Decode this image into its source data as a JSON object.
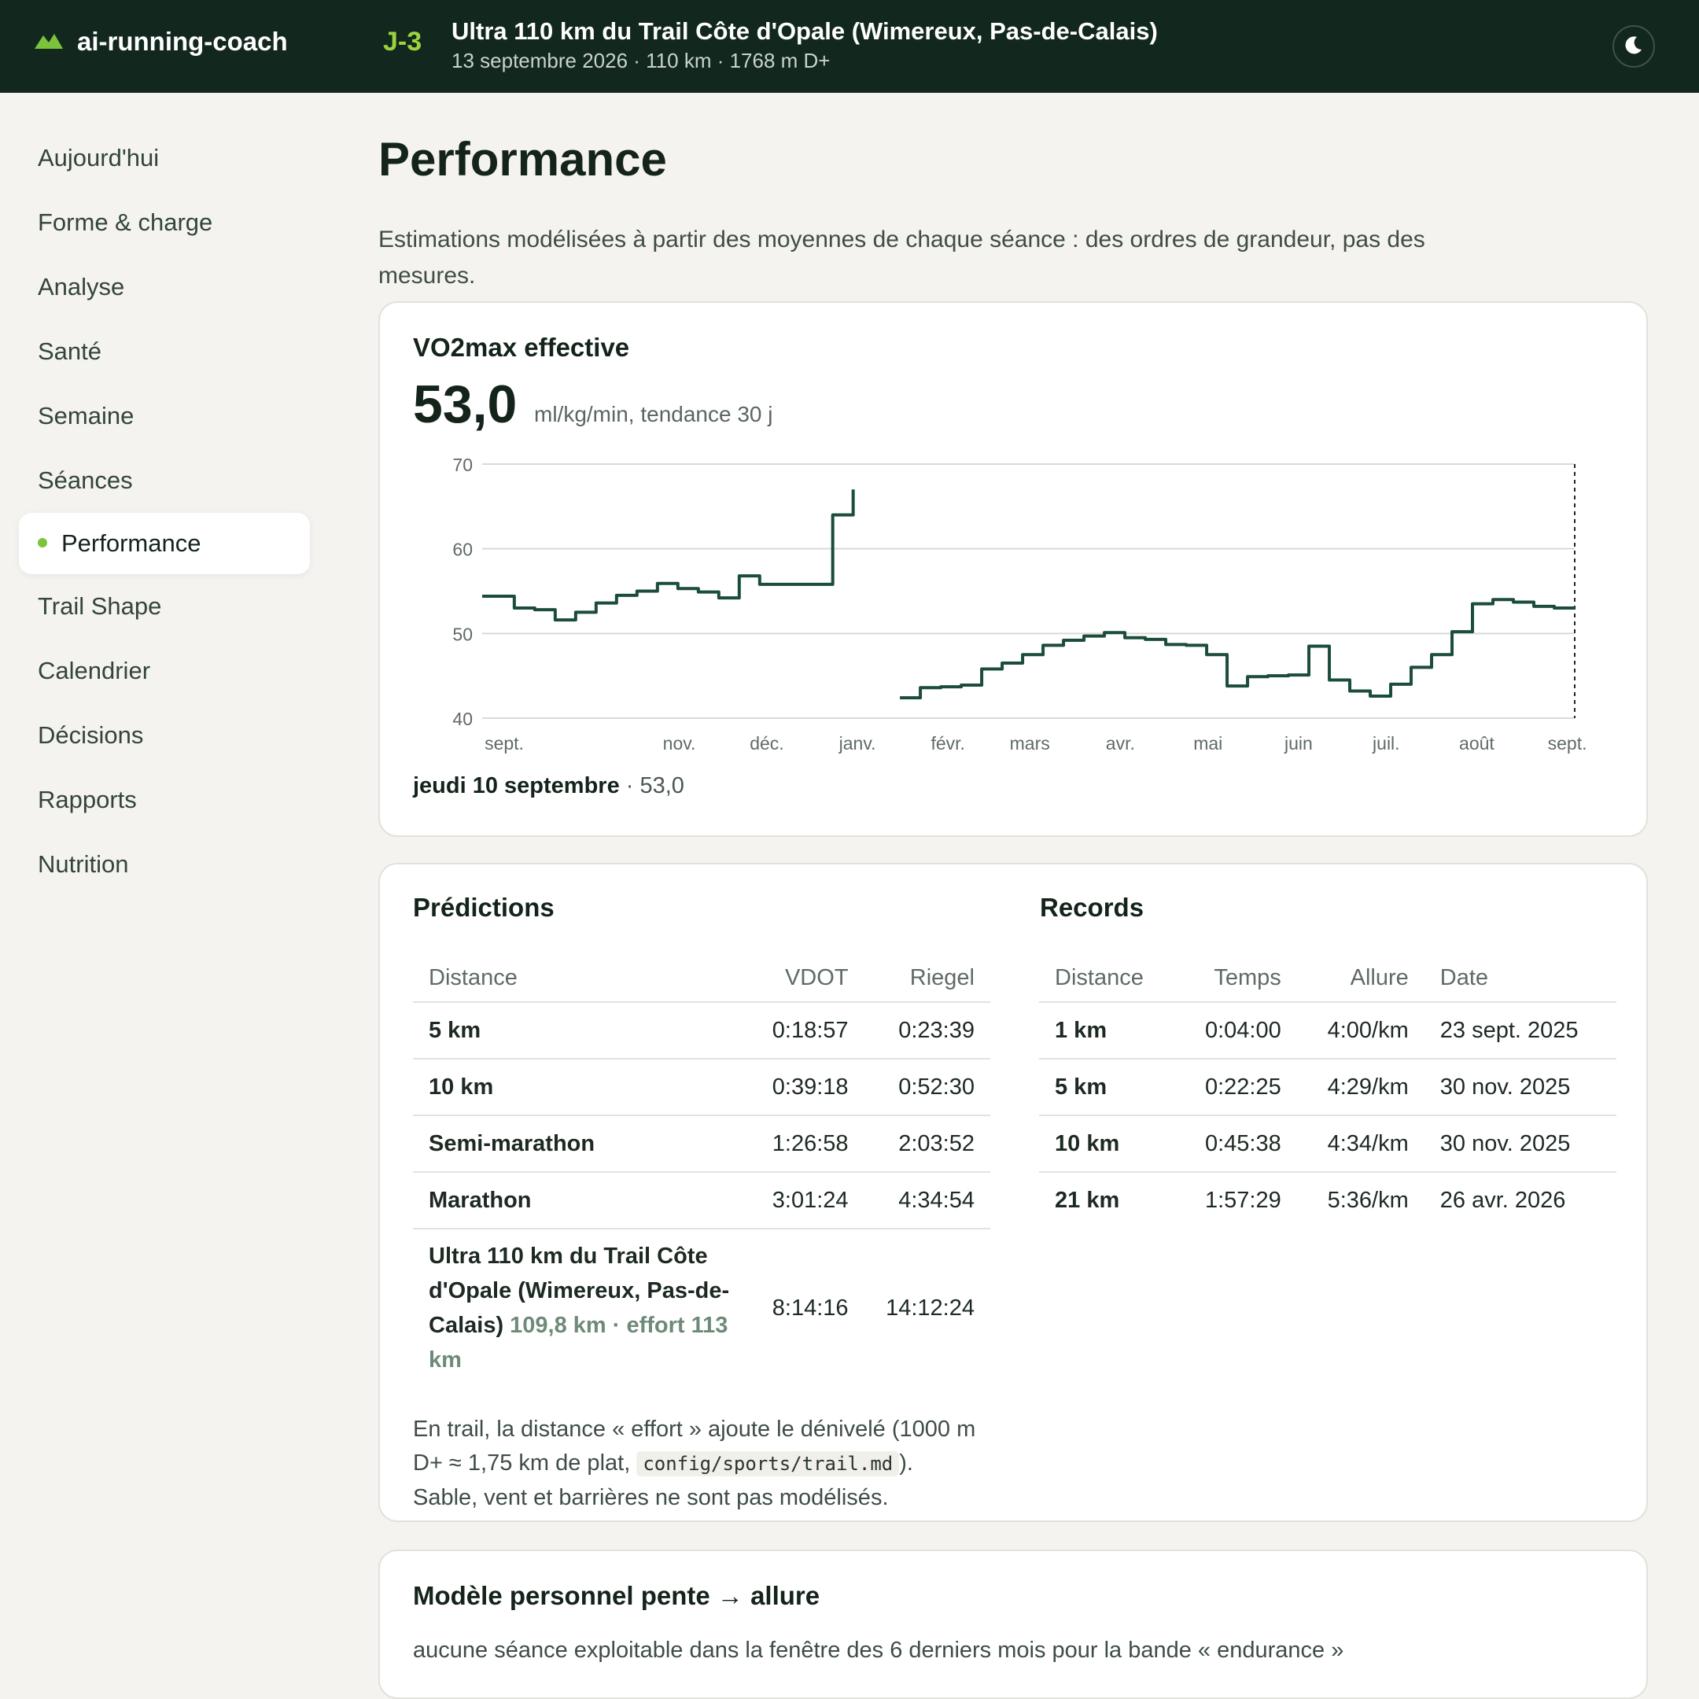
{
  "header": {
    "brand": "ai-running-coach",
    "countdown": "J-3",
    "race_title": "Ultra 110 km du Trail Côte d'Opale (Wimereux, Pas-de-Calais)",
    "race_subtitle": "13 septembre 2026 · 110 km · 1768 m D+"
  },
  "sidebar": {
    "items": [
      {
        "label": "Aujourd'hui"
      },
      {
        "label": "Forme & charge"
      },
      {
        "label": "Analyse"
      },
      {
        "label": "Santé"
      },
      {
        "label": "Semaine"
      },
      {
        "label": "Séances"
      },
      {
        "label": "Performance",
        "active": true
      },
      {
        "label": "Trail Shape"
      },
      {
        "label": "Calendrier"
      },
      {
        "label": "Décisions"
      },
      {
        "label": "Rapports"
      },
      {
        "label": "Nutrition"
      }
    ]
  },
  "page": {
    "title": "Performance",
    "description": "Estimations modélisées à partir des moyennes de chaque séance : des ordres de grandeur, pas des mesures."
  },
  "vo2": {
    "title": "VO2max effective",
    "value": "53,0",
    "unit": "ml/kg/min, tendance 30 j",
    "footer_date": "jeudi 10 septembre",
    "footer_value": "· 53,0"
  },
  "chart_data": {
    "type": "line",
    "title": "VO2max effective",
    "ylim": [
      40,
      70
    ],
    "yticks": [
      "70",
      "60",
      "50",
      "40"
    ],
    "xticks": [
      "sept.",
      "nov.",
      "déc.",
      "janv.",
      "févr.",
      "mars",
      "avr.",
      "mai",
      "juin",
      "juil.",
      "août",
      "sept."
    ],
    "grid": true,
    "series": [
      {
        "x": [
          "2025-09-01",
          "2025-09-08",
          "2025-09-12",
          "2025-09-19",
          "2025-09-26",
          "2025-10-03",
          "2025-10-10",
          "2025-10-17",
          "2025-10-24",
          "2025-10-31",
          "2025-11-07",
          "2025-11-14",
          "2025-11-21",
          "2025-11-28",
          "2025-12-05",
          "2025-12-12",
          "2025-12-19",
          "2025-12-26",
          "2025-12-30",
          "2026-01-03",
          "2026-01-06"
        ],
        "y": [
          54.4,
          54.4,
          53.0,
          52.8,
          51.6,
          52.5,
          53.6,
          54.5,
          55.0,
          55.9,
          55.3,
          54.9,
          54.2,
          56.8,
          55.8,
          55.8,
          55.8,
          55.8,
          64.0,
          64.0,
          67.0
        ]
      },
      {
        "x": [
          "2026-01-22",
          "2026-01-29",
          "2026-02-05",
          "2026-02-12",
          "2026-02-19",
          "2026-02-26",
          "2026-03-05",
          "2026-03-12",
          "2026-03-19",
          "2026-03-26",
          "2026-04-02",
          "2026-04-09",
          "2026-04-16",
          "2026-04-23",
          "2026-04-30",
          "2026-05-07",
          "2026-05-14",
          "2026-05-21",
          "2026-05-28",
          "2026-06-04",
          "2026-06-11",
          "2026-06-18",
          "2026-06-25",
          "2026-07-02",
          "2026-07-09",
          "2026-07-16",
          "2026-07-23",
          "2026-07-30",
          "2026-08-06",
          "2026-08-13",
          "2026-08-20",
          "2026-08-27",
          "2026-09-03",
          "2026-09-10"
        ],
        "y": [
          42.4,
          43.6,
          43.7,
          43.9,
          45.8,
          46.5,
          47.5,
          48.6,
          49.2,
          49.7,
          50.1,
          49.5,
          49.3,
          48.7,
          48.6,
          47.5,
          43.8,
          44.9,
          45.0,
          45.1,
          48.5,
          44.5,
          43.2,
          42.6,
          44.0,
          46.0,
          47.5,
          50.2,
          53.5,
          54.0,
          53.7,
          53.2,
          53.0,
          53.0
        ]
      }
    ]
  },
  "predictions": {
    "title": "Prédictions",
    "headers": [
      "Distance",
      "VDOT",
      "Riegel"
    ],
    "rows": [
      {
        "distance": "5 km",
        "vdot": "0:18:57",
        "riegel": "0:23:39"
      },
      {
        "distance": "10 km",
        "vdot": "0:39:18",
        "riegel": "0:52:30"
      },
      {
        "distance": "Semi-marathon",
        "vdot": "1:26:58",
        "riegel": "2:03:52"
      },
      {
        "distance": "Marathon",
        "vdot": "3:01:24",
        "riegel": "4:34:54"
      },
      {
        "distance": "Ultra 110 km du Trail Côte d'Opale (Wimereux, Pas-de-Calais)",
        "distance_note": "109,8 km · effort 113 km",
        "vdot": "8:14:16",
        "riegel": "14:12:24"
      }
    ],
    "note_part1": "En trail, la distance « effort » ajoute le dénivelé (1000 m D+ ≈ 1,75 km de plat,",
    "note_code": "config/sports/trail.md",
    "note_part2": "). Sable, vent et barrières ne sont pas modélisés."
  },
  "records": {
    "title": "Records",
    "headers": [
      "Distance",
      "Temps",
      "Allure",
      "Date"
    ],
    "rows": [
      {
        "distance": "1 km",
        "temps": "0:04:00",
        "allure": "4:00/km",
        "date": "23 sept. 2025"
      },
      {
        "distance": "5 km",
        "temps": "0:22:25",
        "allure": "4:29/km",
        "date": "30 nov. 2025"
      },
      {
        "distance": "10 km",
        "temps": "0:45:38",
        "allure": "4:34/km",
        "date": "30 nov. 2025"
      },
      {
        "distance": "21 km",
        "temps": "1:57:29",
        "allure": "5:36/km",
        "date": "26 avr. 2026"
      }
    ]
  },
  "model": {
    "title": "Modèle personnel pente → allure",
    "text": "aucune séance exploitable dans la fenêtre des 6 derniers mois pour la bande « endurance »"
  },
  "colors": {
    "topbar": "#12281f",
    "accent": "#9bd33c",
    "line": "#1b4d3a",
    "active_dot": "#7cc23a"
  },
  "icons": {
    "brand": "mountain-icon",
    "theme": "moon-icon"
  }
}
